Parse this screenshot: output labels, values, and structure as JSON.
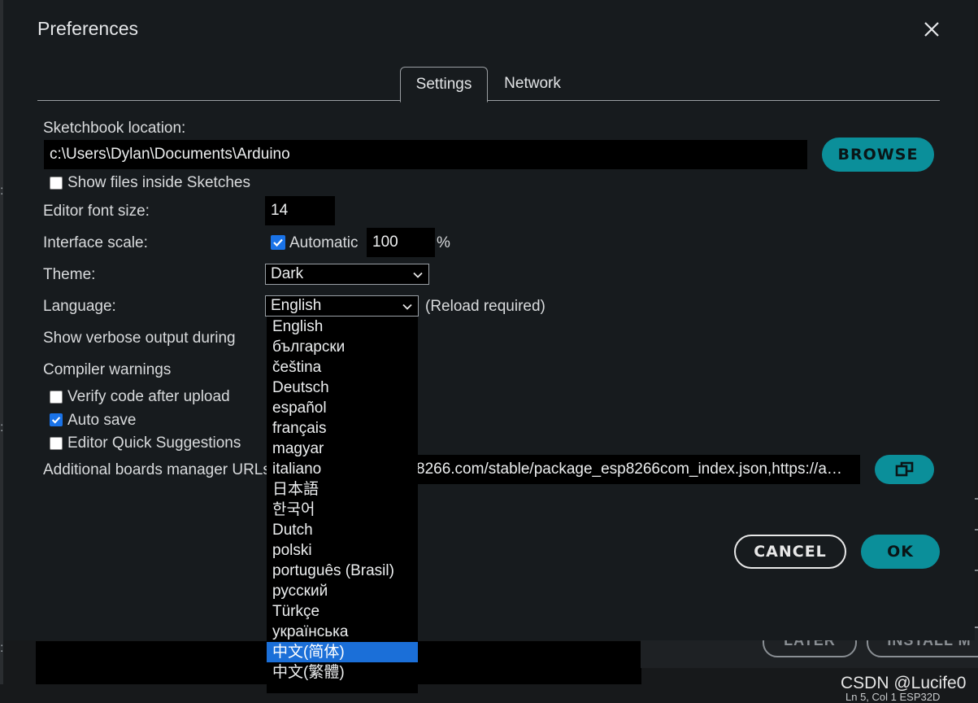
{
  "dialog": {
    "title": "Preferences"
  },
  "tabs": [
    {
      "label": "Settings"
    },
    {
      "label": "Network"
    }
  ],
  "settings": {
    "sketchbook_label": "Sketchbook location:",
    "sketchbook_path": "c:\\Users\\Dylan\\Documents\\Arduino",
    "browse_label": "BROWSE",
    "show_files_label": "Show files inside Sketches",
    "font_size_label": "Editor font size:",
    "font_size_value": "14",
    "scale_label": "Interface scale:",
    "scale_auto_label": "Automatic",
    "scale_value": "100",
    "scale_unit": "%",
    "theme_label": "Theme:",
    "theme_value": "Dark",
    "language_label": "Language:",
    "language_value": "English",
    "reload_note": "(Reload required)",
    "verbose_label": "Show verbose output during",
    "compiler_label": "Compiler warnings",
    "verify_label": "Verify code after upload",
    "autosave_label": "Auto save",
    "quick_suggest_label": "Editor Quick Suggestions",
    "boards_url_label": "Additional boards manager URLs",
    "boards_url_value": "8266.com/stable/package_esp8266com_index.json,https://a…",
    "checkboxes": {
      "show_files": false,
      "scale_auto": true,
      "verify": false,
      "autosave": true,
      "quick_suggest": false
    }
  },
  "language_options": [
    "English",
    "български",
    "čeština",
    "Deutsch",
    "español",
    "français",
    "magyar",
    "italiano",
    "日本語",
    "한국어",
    "Dutch",
    "polski",
    "português (Brasil)",
    "русский",
    "Türkçe",
    "українська",
    "中文(简体)",
    "中文(繁體)"
  ],
  "language_highlighted": "中文(简体)",
  "actions": {
    "cancel_label": "CANCEL",
    "ok_label": "OK"
  },
  "background": {
    "notif_btn1": "LATER",
    "notif_btn2": "INSTALL M",
    "status_text": "Ln 5, Col 1    ESP32D",
    "watermark": "CSDN @Lucife0"
  },
  "colors": {
    "accent": "#0b8f9a",
    "dialog_bg": "#171b1e",
    "highlight": "#1b6fd8",
    "checkbox_on": "#1a73e8"
  }
}
